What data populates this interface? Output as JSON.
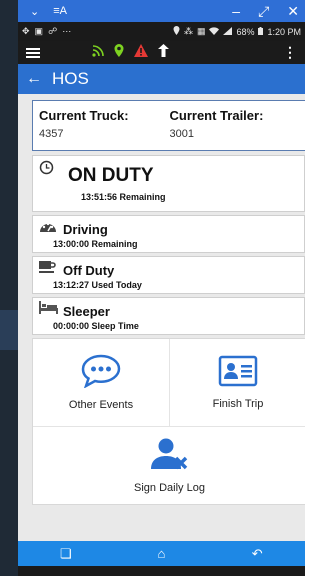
{
  "emulator": {
    "title": "≡A",
    "battery": "68%",
    "time": "1:20 PM"
  },
  "appbar": {
    "title": "HOS"
  },
  "truck": {
    "truck_label": "Current Truck:",
    "truck_value": "4357",
    "trailer_label": "Current Trailer:",
    "trailer_value": "3001"
  },
  "statuses": [
    {
      "name": "ON DUTY",
      "detail": "13:51:56 Remaining",
      "icon": "clock-icon"
    },
    {
      "name": "Driving",
      "detail": "13:00:00 Remaining",
      "icon": "speedometer-icon"
    },
    {
      "name": "Off Duty",
      "detail": "13:12:27 Used Today",
      "icon": "coffee-cup-icon"
    },
    {
      "name": "Sleeper",
      "detail": "00:00:00 Sleep Time",
      "icon": "bed-icon"
    }
  ],
  "actions": {
    "other_events": "Other Events",
    "finish_trip": "Finish Trip",
    "sign_daily_log": "Sign Daily Log"
  },
  "colors": {
    "app_blue": "#2b70cf",
    "nav_blue": "#1e88e5",
    "green": "#7ed321",
    "red": "#e53935"
  }
}
